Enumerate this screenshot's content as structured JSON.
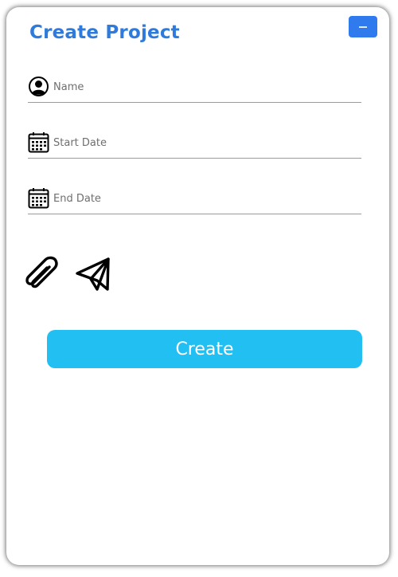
{
  "form": {
    "title": "Create Project",
    "minimize_label": "−",
    "fields": [
      {
        "name": "name",
        "icon": "user-circle-icon",
        "placeholder": "Name",
        "value": ""
      },
      {
        "name": "start_date",
        "icon": "calendar-icon",
        "placeholder": "Start Date",
        "value": ""
      },
      {
        "name": "end_date",
        "icon": "calendar-icon",
        "placeholder": "End Date",
        "value": ""
      }
    ],
    "actions": {
      "attach_icon": "paperclip-icon",
      "send_icon": "paper-plane-icon"
    },
    "submit_label": "Create"
  },
  "colors": {
    "title": "#2f7bdb",
    "minimize_button": "#2f7bee",
    "submit_button": "#22bff2",
    "underline": "#9b9b9b"
  }
}
